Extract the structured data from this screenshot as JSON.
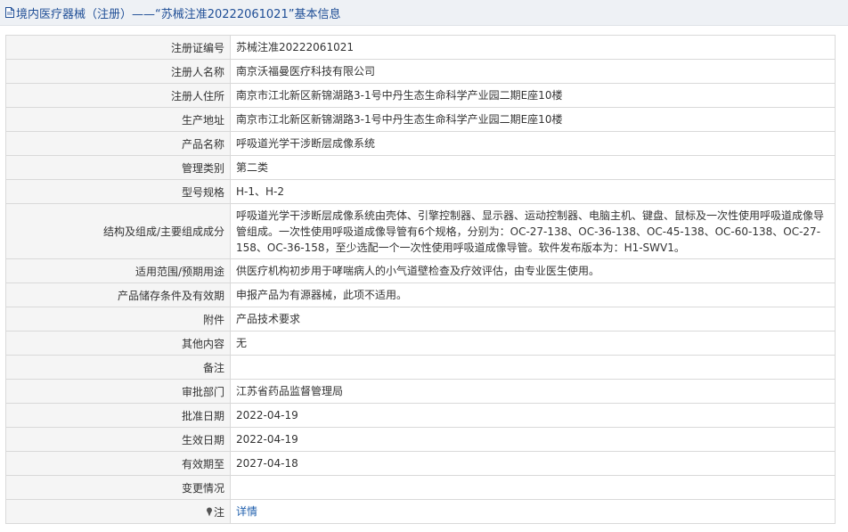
{
  "page": {
    "title": "境内医疗器械（注册）——“苏械注准20222061021”基本信息"
  },
  "icons": {
    "title_icon": "document-icon",
    "note_icon": "pin-icon"
  },
  "colors": {
    "title_text": "#1f4e96",
    "link": "#1f5fad",
    "label_bg": "#f5f5f5",
    "border": "#d9d9d9"
  },
  "rows": [
    {
      "label": "注册证编号",
      "value": "苏械注准20222061021"
    },
    {
      "label": "注册人名称",
      "value": "南京沃福曼医疗科技有限公司"
    },
    {
      "label": "注册人住所",
      "value": "南京市江北新区新锦湖路3-1号中丹生态生命科学产业园二期E座10楼"
    },
    {
      "label": "生产地址",
      "value": "南京市江北新区新锦湖路3-1号中丹生态生命科学产业园二期E座10楼"
    },
    {
      "label": "产品名称",
      "value": "呼吸道光学干涉断层成像系统"
    },
    {
      "label": "管理类别",
      "value": "第二类"
    },
    {
      "label": "型号规格",
      "value": "H-1、H-2"
    },
    {
      "label": "结构及组成/主要组成成分",
      "value": "呼吸道光学干涉断层成像系统由壳体、引擎控制器、显示器、运动控制器、电脑主机、键盘、鼠标及一次性使用呼吸道成像导管组成。一次性使用呼吸道成像导管有6个规格，分别为：OC-27-138、OC-36-138、OC-45-138、OC-60-138、OC-27-158、OC-36-158，至少选配一个一次性使用呼吸道成像导管。软件发布版本为：H1-SWV1。"
    },
    {
      "label": "适用范围/预期用途",
      "value": "供医疗机构初步用于哮喘病人的小气道壁检查及疗效评估，由专业医生使用。"
    },
    {
      "label": "产品储存条件及有效期",
      "value": "申报产品为有源器械，此项不适用。"
    },
    {
      "label": "附件",
      "value": "产品技术要求"
    },
    {
      "label": "其他内容",
      "value": "无"
    },
    {
      "label": "备注",
      "value": ""
    },
    {
      "label": "审批部门",
      "value": "江苏省药品监督管理局"
    },
    {
      "label": "批准日期",
      "value": "2022-04-19"
    },
    {
      "label": "生效日期",
      "value": "2022-04-19"
    },
    {
      "label": "有效期至",
      "value": "2027-04-18"
    },
    {
      "label": "变更情况",
      "value": ""
    }
  ],
  "note_row": {
    "label": "注",
    "link_text": "详情"
  }
}
